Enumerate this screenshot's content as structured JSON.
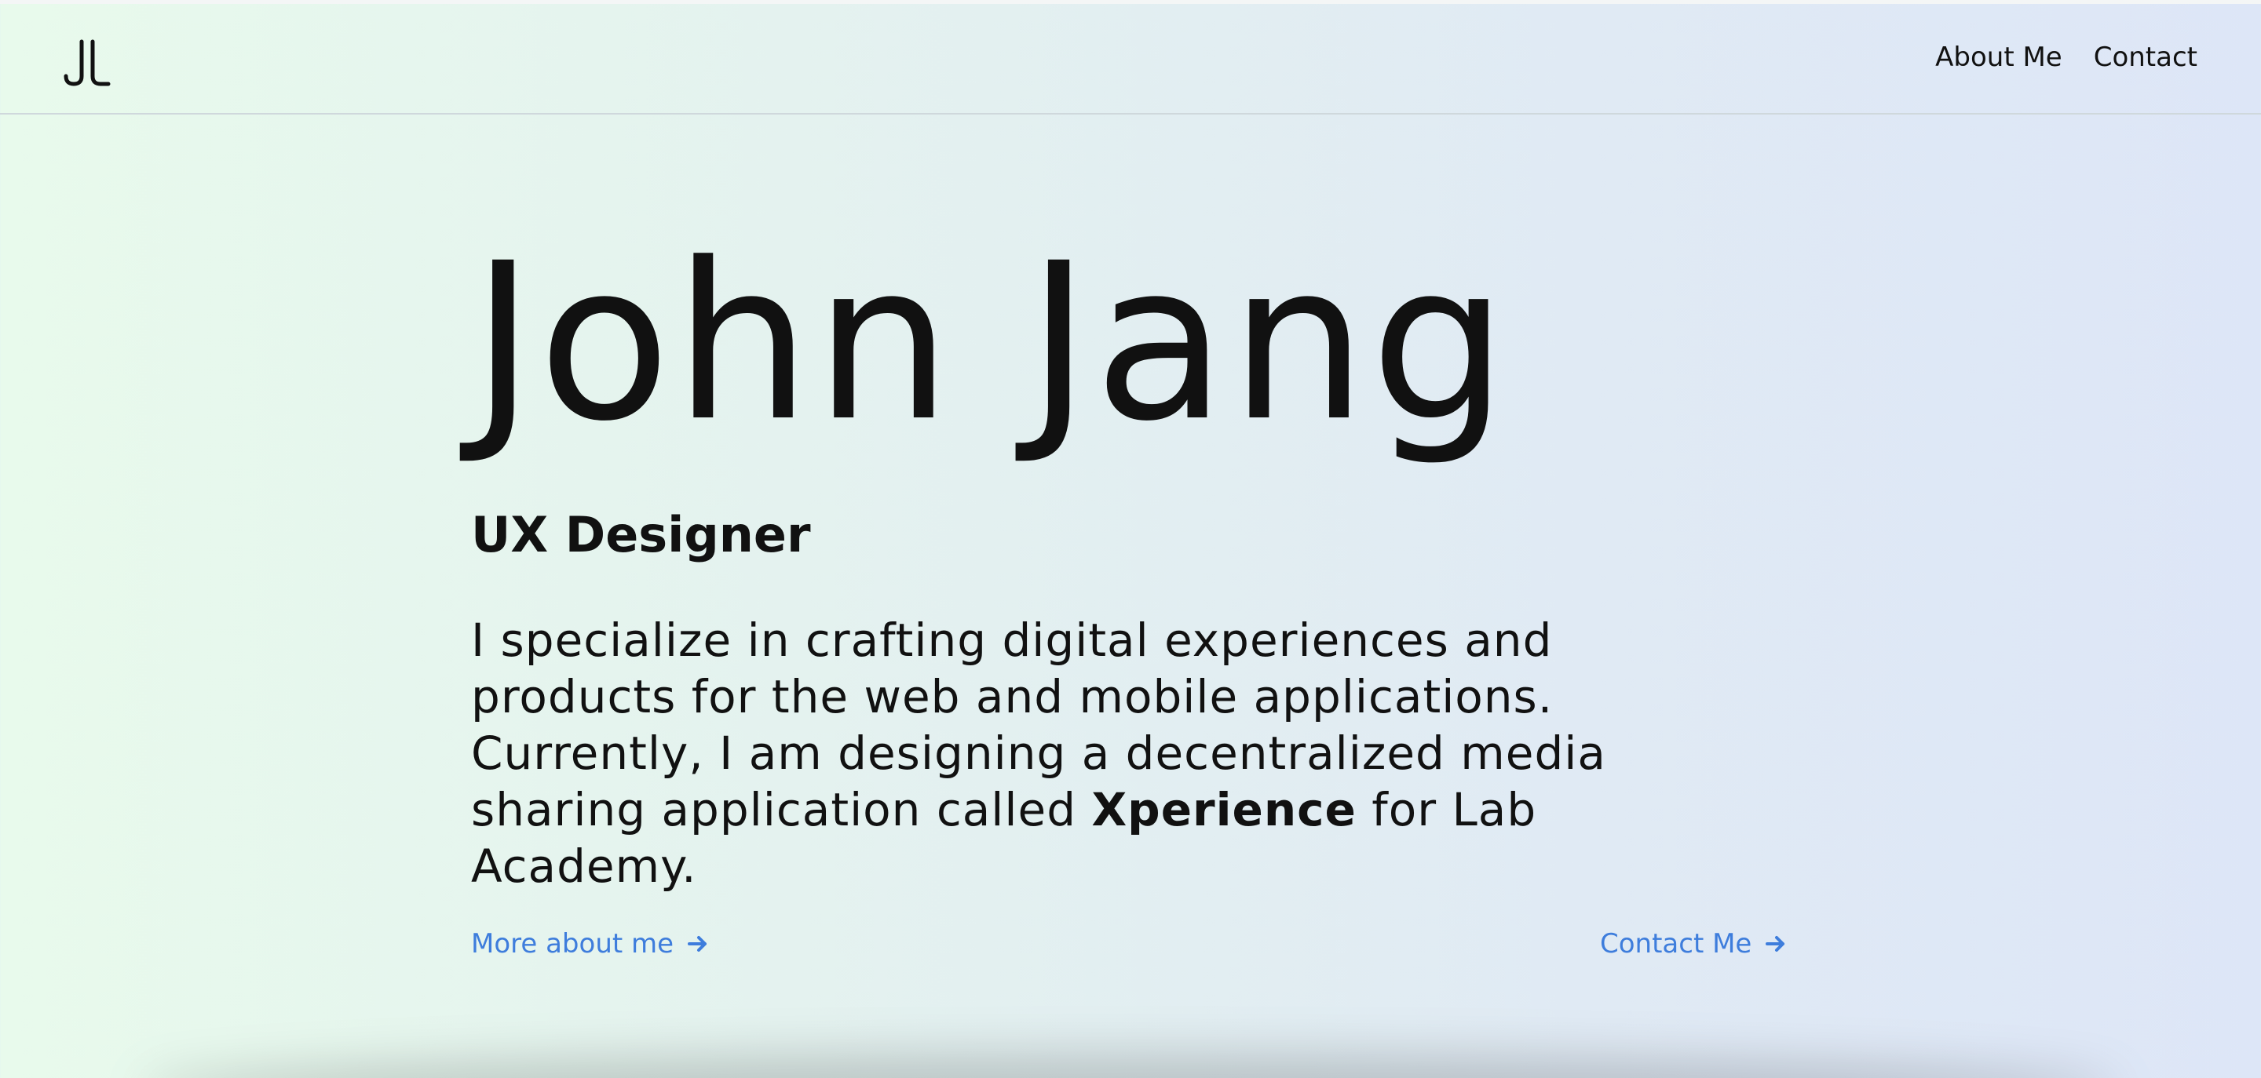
{
  "header": {
    "logo_alt": "JJ",
    "nav": [
      {
        "label": "About Me"
      },
      {
        "label": "Contact"
      }
    ]
  },
  "hero": {
    "name": "John Jang",
    "role": "UX Designer",
    "bio_part1": "I specialize in crafting digital experiences and products for the web and mobile applications. Currently, I am designing a decentralized media sharing application called ",
    "bio_highlight": "Xperience",
    "bio_part2": " for Lab Academy."
  },
  "cta": {
    "more_about": "More about me",
    "contact": "Contact Me"
  },
  "icons": {
    "logo": "jj-monogram-icon",
    "arrow": "arrow-right-icon"
  },
  "colors": {
    "link": "#3e7ddc",
    "text": "#111111",
    "gradient_start": "#e8faec",
    "gradient_end": "#dde6f7"
  }
}
